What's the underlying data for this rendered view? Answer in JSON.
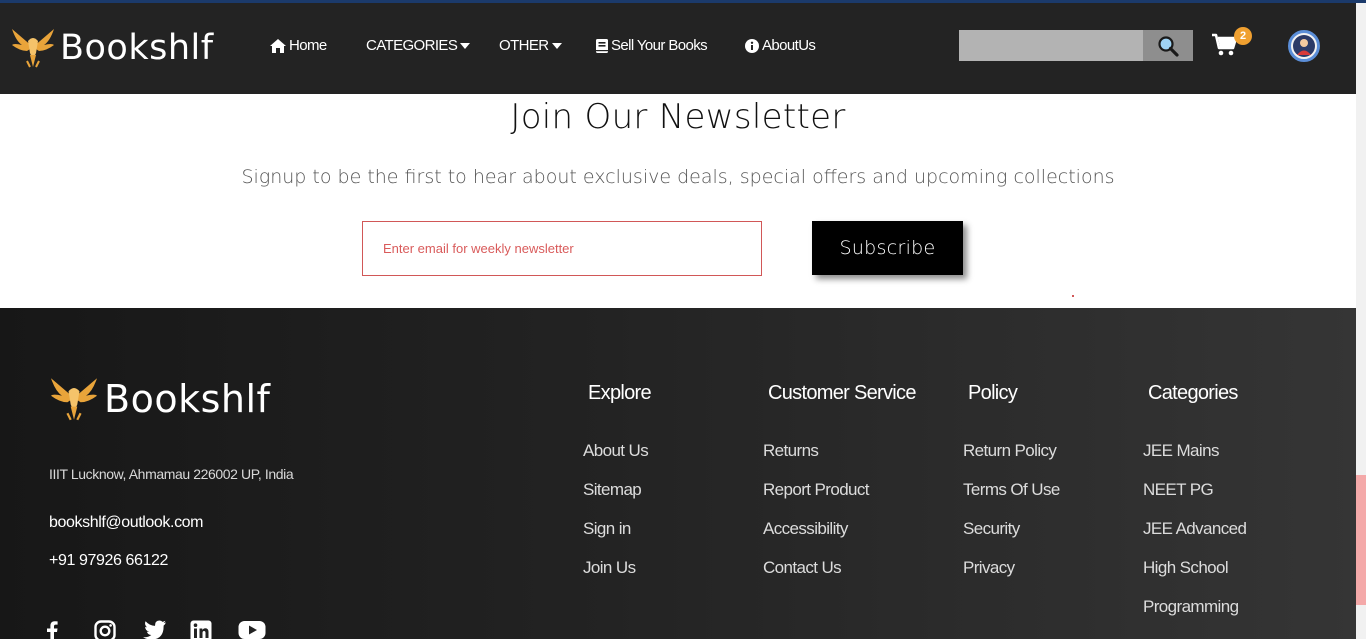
{
  "brand": {
    "name": "Bookshlf",
    "accent": "#f0a030"
  },
  "nav": {
    "home": "Home",
    "categories": "CATEGORIES",
    "other": "OTHER",
    "sell": "Sell Your Books",
    "about": "AboutUs",
    "search_placeholder": "",
    "cart_count": "2",
    "icons": [
      "home-icon",
      "caret-down-icon",
      "book-icon",
      "info-icon",
      "search-icon",
      "cart-icon",
      "user-avatar-icon"
    ]
  },
  "newsletter": {
    "title": "Join Our Newsletter",
    "subtitle": "Signup to be the first to hear about exclusive deals, special offers and upcoming collections",
    "email_placeholder": "Enter email for weekly newsletter",
    "subscribe_label": "Subscribe"
  },
  "footer": {
    "address": "IIIT Lucknow, Ahmamau 226002 UP, India",
    "email": "bookshlf@outlook.com",
    "phone": "+91 97926 66122",
    "socials": [
      "facebook-icon",
      "instagram-icon",
      "twitter-icon",
      "linkedin-icon",
      "youtube-icon"
    ],
    "columns": [
      {
        "title": "Explore",
        "links": [
          "About Us",
          "Sitemap",
          "Sign in",
          "Join Us"
        ]
      },
      {
        "title": "Customer Service",
        "links": [
          "Returns",
          "Report Product",
          "Accessibility",
          "Contact Us"
        ]
      },
      {
        "title": "Policy",
        "links": [
          "Return Policy",
          "Terms Of Use",
          "Security",
          "Privacy"
        ]
      },
      {
        "title": "Categories",
        "links": [
          "JEE Mains",
          "NEET PG",
          "JEE Advanced",
          "High School",
          "Programming"
        ]
      }
    ]
  }
}
